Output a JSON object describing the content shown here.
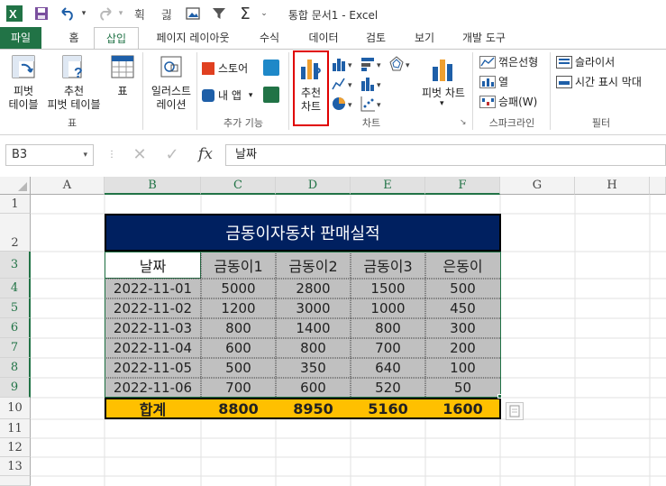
{
  "window": {
    "title": "통합 문서1 - Excel"
  },
  "quick_access": {
    "excel_icon": "excel-logo-icon",
    "save_icon": "save-icon",
    "undo_icon": "undo-icon",
    "redo_icon": "redo-icon",
    "customize_icon": "chevron-down-icon"
  },
  "tabs": [
    {
      "label": "파일"
    },
    {
      "label": "홈"
    },
    {
      "label": "삽입"
    },
    {
      "label": "페이지 레이아웃"
    },
    {
      "label": "수식"
    },
    {
      "label": "데이터"
    },
    {
      "label": "검토"
    },
    {
      "label": "보기"
    },
    {
      "label": "개발 도구"
    }
  ],
  "ribbon": {
    "groups": {
      "table": "표",
      "addins": "추가 기능",
      "charts": "차트",
      "sparklines": "스파크라인",
      "filters": "필터"
    },
    "pivot_table": [
      "피벗",
      "테이블"
    ],
    "recommended_pivot": [
      "추천",
      "피벗 테이블"
    ],
    "table": "표",
    "illustrations": [
      "일러스트",
      "레이션"
    ],
    "store": "스토어",
    "my_apps": "내 앱",
    "recommended_charts": [
      "추천",
      "차트"
    ],
    "pivot_chart": "피벗 차트",
    "line_spark": "꺾은선형",
    "column_spark": "열",
    "winloss_spark": "승패(W)",
    "slicer": "슬라이서",
    "timeline": "시간 표시 막대"
  },
  "formula_bar": {
    "name_box": "B3",
    "fx": "fx",
    "value": "날짜"
  },
  "grid": {
    "columns": [
      "A",
      "B",
      "C",
      "D",
      "E",
      "F",
      "G",
      "H"
    ],
    "rows": [
      "1",
      "2",
      "3",
      "4",
      "5",
      "6",
      "7",
      "8",
      "9",
      "10",
      "11",
      "12",
      "13"
    ]
  },
  "table": {
    "title": "금동이자동차  판매실적",
    "headers": [
      "날짜",
      "금동이1",
      "금동이2",
      "금동이3",
      "은동이"
    ],
    "rows": [
      [
        "2022-11-01",
        "5000",
        "2800",
        "1500",
        "500"
      ],
      [
        "2022-11-02",
        "1200",
        "3000",
        "1000",
        "450"
      ],
      [
        "2022-11-03",
        "800",
        "1400",
        "800",
        "300"
      ],
      [
        "2022-11-04",
        "600",
        "800",
        "700",
        "200"
      ],
      [
        "2022-11-05",
        "500",
        "350",
        "640",
        "100"
      ],
      [
        "2022-11-06",
        "700",
        "600",
        "520",
        "50"
      ]
    ],
    "totals": [
      "합계",
      "8800",
      "8950",
      "5160",
      "1600"
    ]
  },
  "colors": {
    "excel_green": "#217346",
    "title_bg": "#002060",
    "data_bg": "#c0c0c0",
    "total_bg": "#ffc000",
    "highlight_red": "#e00000"
  }
}
